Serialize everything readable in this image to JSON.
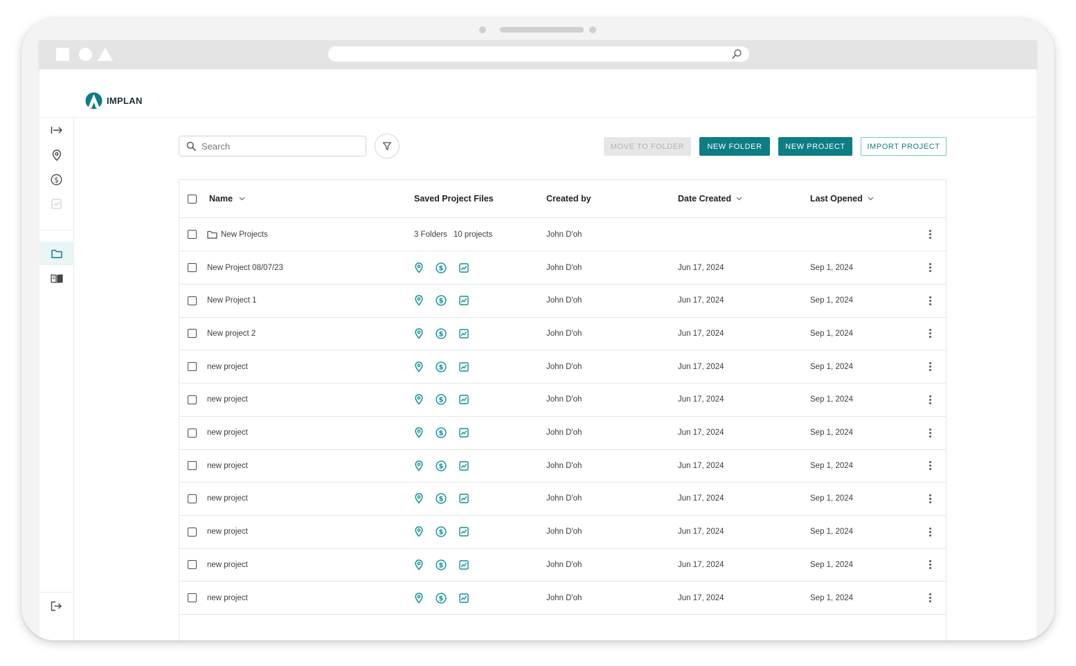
{
  "brand": {
    "name": "IMPLAN",
    "accent": "#0d7d85"
  },
  "search": {
    "placeholder": "Search"
  },
  "toolbar": {
    "move_to_folder": "MOVE TO FOLDER",
    "new_folder": "NEW FOLDER",
    "new_project": "NEW PROJECT",
    "import_project": "IMPORT PROJECT"
  },
  "sidebar": {
    "items": [
      "expand-icon",
      "map-pin-icon",
      "dollar-icon",
      "chart-icon",
      "folder-icon",
      "book-icon"
    ],
    "active": "folder-icon",
    "bottom": "logout-icon"
  },
  "table": {
    "columns": {
      "name": "Name",
      "files": "Saved Project Files",
      "created_by": "Created by",
      "date_created": "Date Created",
      "last_opened": "Last Opened"
    },
    "folder": {
      "name": "New Projects",
      "folders": "3 Folders",
      "projects": "10 projects",
      "created_by": "John D'oh"
    },
    "rows": [
      {
        "name": "New Project 08/07/23",
        "created_by": "John D'oh",
        "date_created": "Jun 17, 2024",
        "last_opened": "Sep 1, 2024"
      },
      {
        "name": "New Project 1",
        "created_by": "John D'oh",
        "date_created": "Jun 17, 2024",
        "last_opened": "Sep 1, 2024"
      },
      {
        "name": "New project 2",
        "created_by": "John D'oh",
        "date_created": "Jun 17, 2024",
        "last_opened": "Sep 1, 2024"
      },
      {
        "name": "new project",
        "created_by": "John D'oh",
        "date_created": "Jun 17, 2024",
        "last_opened": "Sep 1, 2024"
      },
      {
        "name": "new project",
        "created_by": "John D'oh",
        "date_created": "Jun 17, 2024",
        "last_opened": "Sep 1, 2024"
      },
      {
        "name": "new project",
        "created_by": "John D'oh",
        "date_created": "Jun 17, 2024",
        "last_opened": "Sep 1, 2024"
      },
      {
        "name": "new project",
        "created_by": "John D'oh",
        "date_created": "Jun 17, 2024",
        "last_opened": "Sep 1, 2024"
      },
      {
        "name": "new project",
        "created_by": "John D'oh",
        "date_created": "Jun 17, 2024",
        "last_opened": "Sep 1, 2024"
      },
      {
        "name": "new project",
        "created_by": "John D'oh",
        "date_created": "Jun 17, 2024",
        "last_opened": "Sep 1, 2024"
      },
      {
        "name": "new project",
        "created_by": "John D'oh",
        "date_created": "Jun 17, 2024",
        "last_opened": "Sep 1, 2024"
      },
      {
        "name": "new project",
        "created_by": "John D'oh",
        "date_created": "Jun 17, 2024",
        "last_opened": "Sep 1, 2024"
      }
    ],
    "file_icons": [
      "map-pin-icon",
      "dollar-icon",
      "chart-icon"
    ]
  }
}
